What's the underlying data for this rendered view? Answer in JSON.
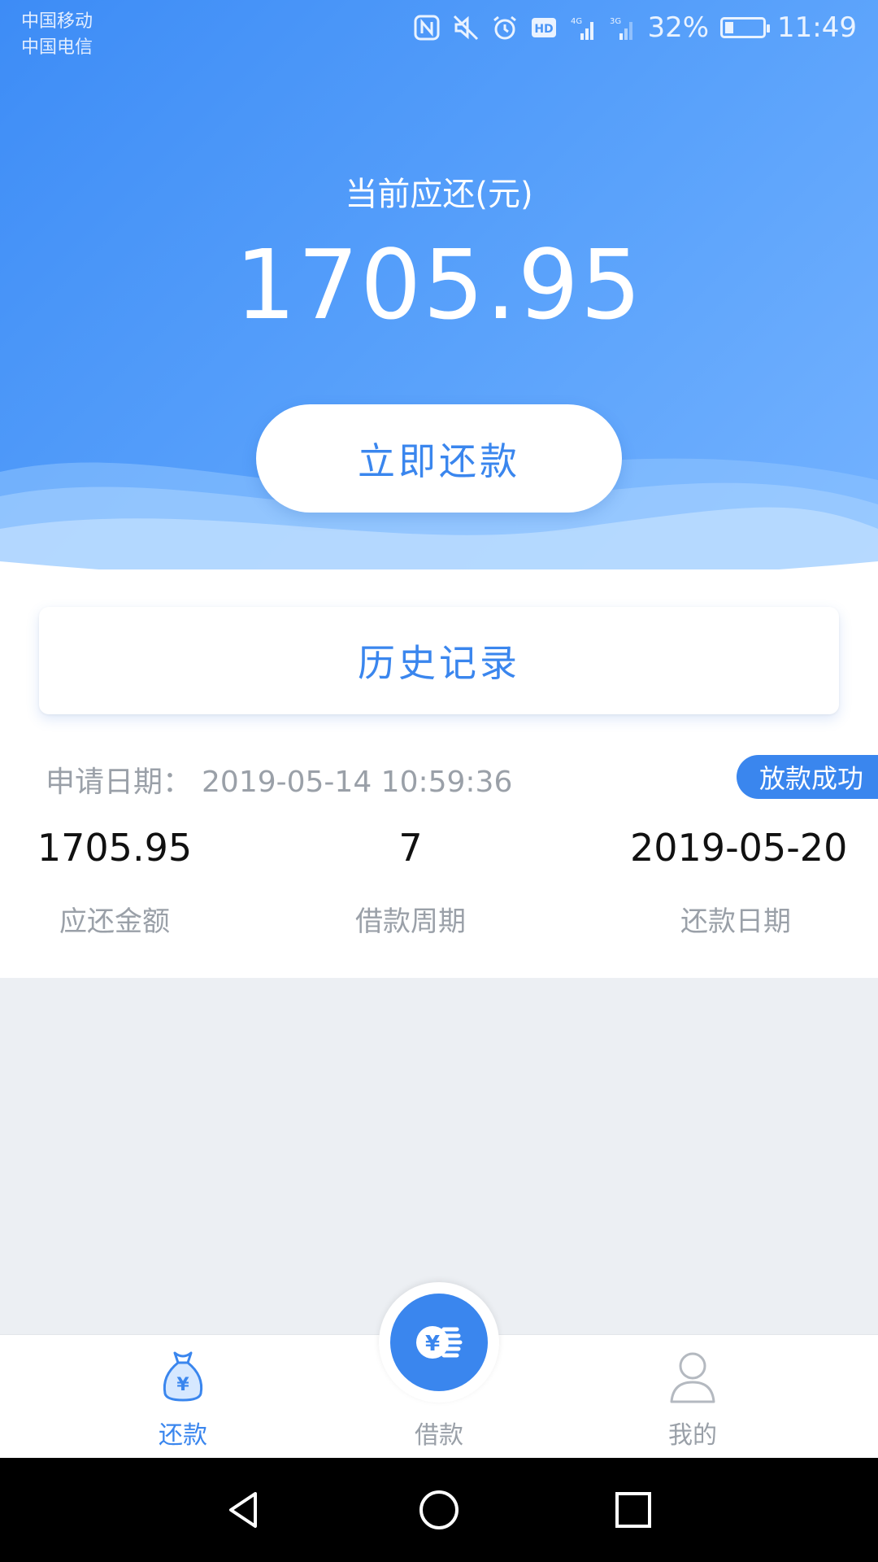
{
  "status_bar": {
    "carrier_1": "中国移动",
    "carrier_2": "中国电信",
    "network_1": "4G",
    "network_2": "3G",
    "battery_percent": "32%",
    "battery_level": 0.32,
    "time": "11:49",
    "icons": [
      "nfc-icon",
      "mute-icon",
      "alarm-icon",
      "hd-icon",
      "signal-icon",
      "battery-icon"
    ]
  },
  "header": {
    "due_label": "当前应还(元)",
    "due_amount": "1705.95",
    "repay_button": "立即还款"
  },
  "history": {
    "title": "历史记录"
  },
  "record": {
    "apply_label": "申请日期：",
    "apply_datetime": "2019-05-14 10:59:36",
    "status": "放款成功",
    "amount_value": "1705.95",
    "amount_label": "应还金额",
    "period_value": "7",
    "period_label": "借款周期",
    "due_date_value": "2019-05-20",
    "due_date_label": "还款日期"
  },
  "tabs": [
    {
      "label": "还款",
      "icon": "money-bag-icon",
      "active": true
    },
    {
      "label": "借款",
      "icon": "yen-coin-icon",
      "active": false
    },
    {
      "label": "我的",
      "icon": "person-icon",
      "active": false
    }
  ],
  "colors": {
    "brand": "#3a86ee",
    "hero_start": "#3d8cf6",
    "hero_end": "#75b3ff",
    "muted_text": "#9aa0a8",
    "page_bg": "#eceff3"
  },
  "nav_bar": {
    "icons": [
      "back-icon",
      "home-icon",
      "recent-apps-icon"
    ]
  }
}
